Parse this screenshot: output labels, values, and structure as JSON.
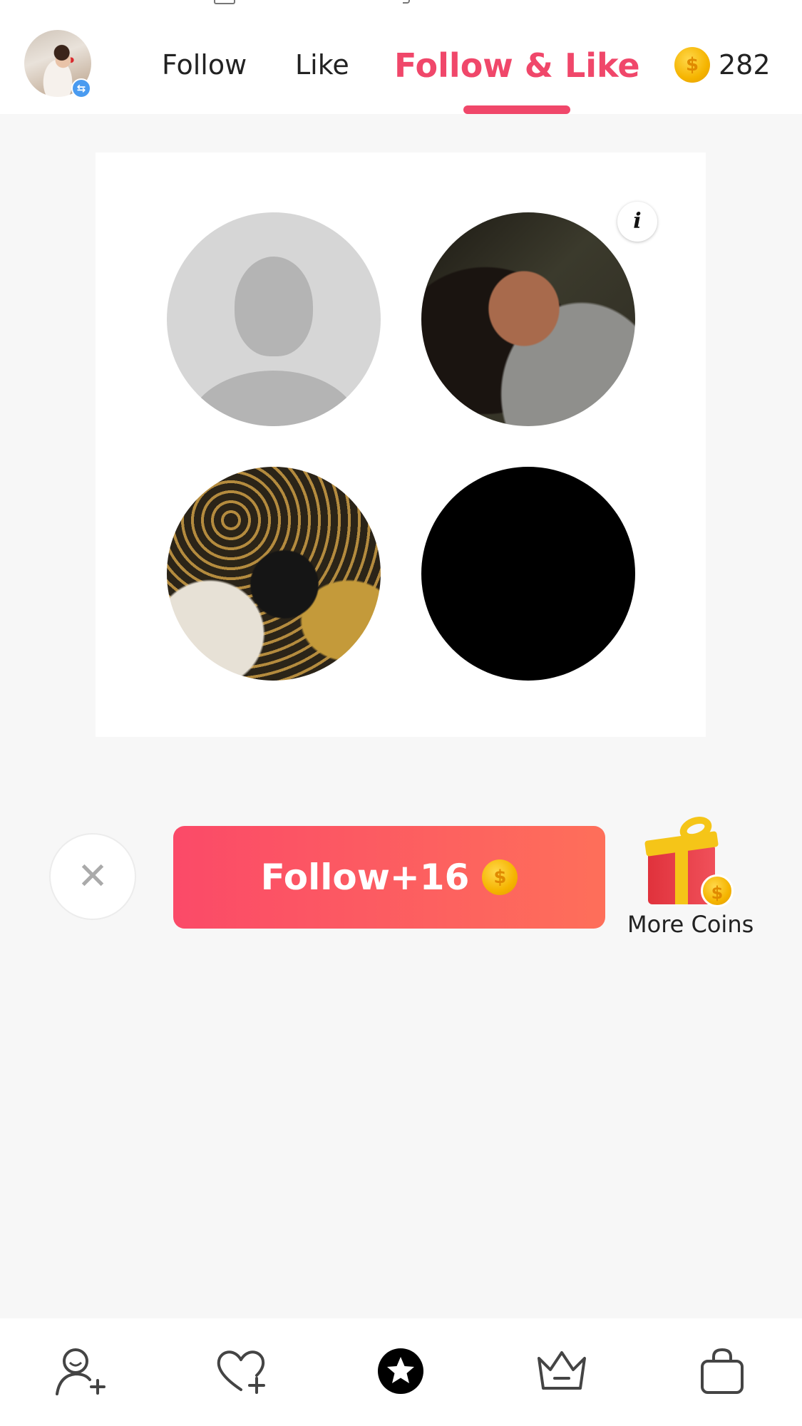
{
  "header": {
    "tabs": [
      {
        "label": "Follow"
      },
      {
        "label": "Like"
      },
      {
        "label": "Follow & Like"
      }
    ],
    "active_tab": "Follow & Like",
    "coin_balance": "282",
    "coin_symbol": "$"
  },
  "card": {
    "info_label": "i",
    "avatars": [
      {
        "kind": "default-silhouette"
      },
      {
        "kind": "photo"
      },
      {
        "kind": "photo"
      },
      {
        "kind": "black"
      }
    ]
  },
  "actions": {
    "close_symbol": "✕",
    "follow_label": "Follow+16",
    "coin_symbol": "$",
    "more_coins_label": "More Coins"
  },
  "bottom_nav": [
    {
      "icon": "add-user-icon"
    },
    {
      "icon": "heart-plus-icon"
    },
    {
      "icon": "star-icon",
      "active": true
    },
    {
      "icon": "crown-icon"
    },
    {
      "icon": "shopping-bag-icon"
    }
  ],
  "colors": {
    "accent": "#f0476a",
    "button_start": "#fb4a68",
    "button_end": "#fe6f5a",
    "coin": "#f5b400"
  }
}
